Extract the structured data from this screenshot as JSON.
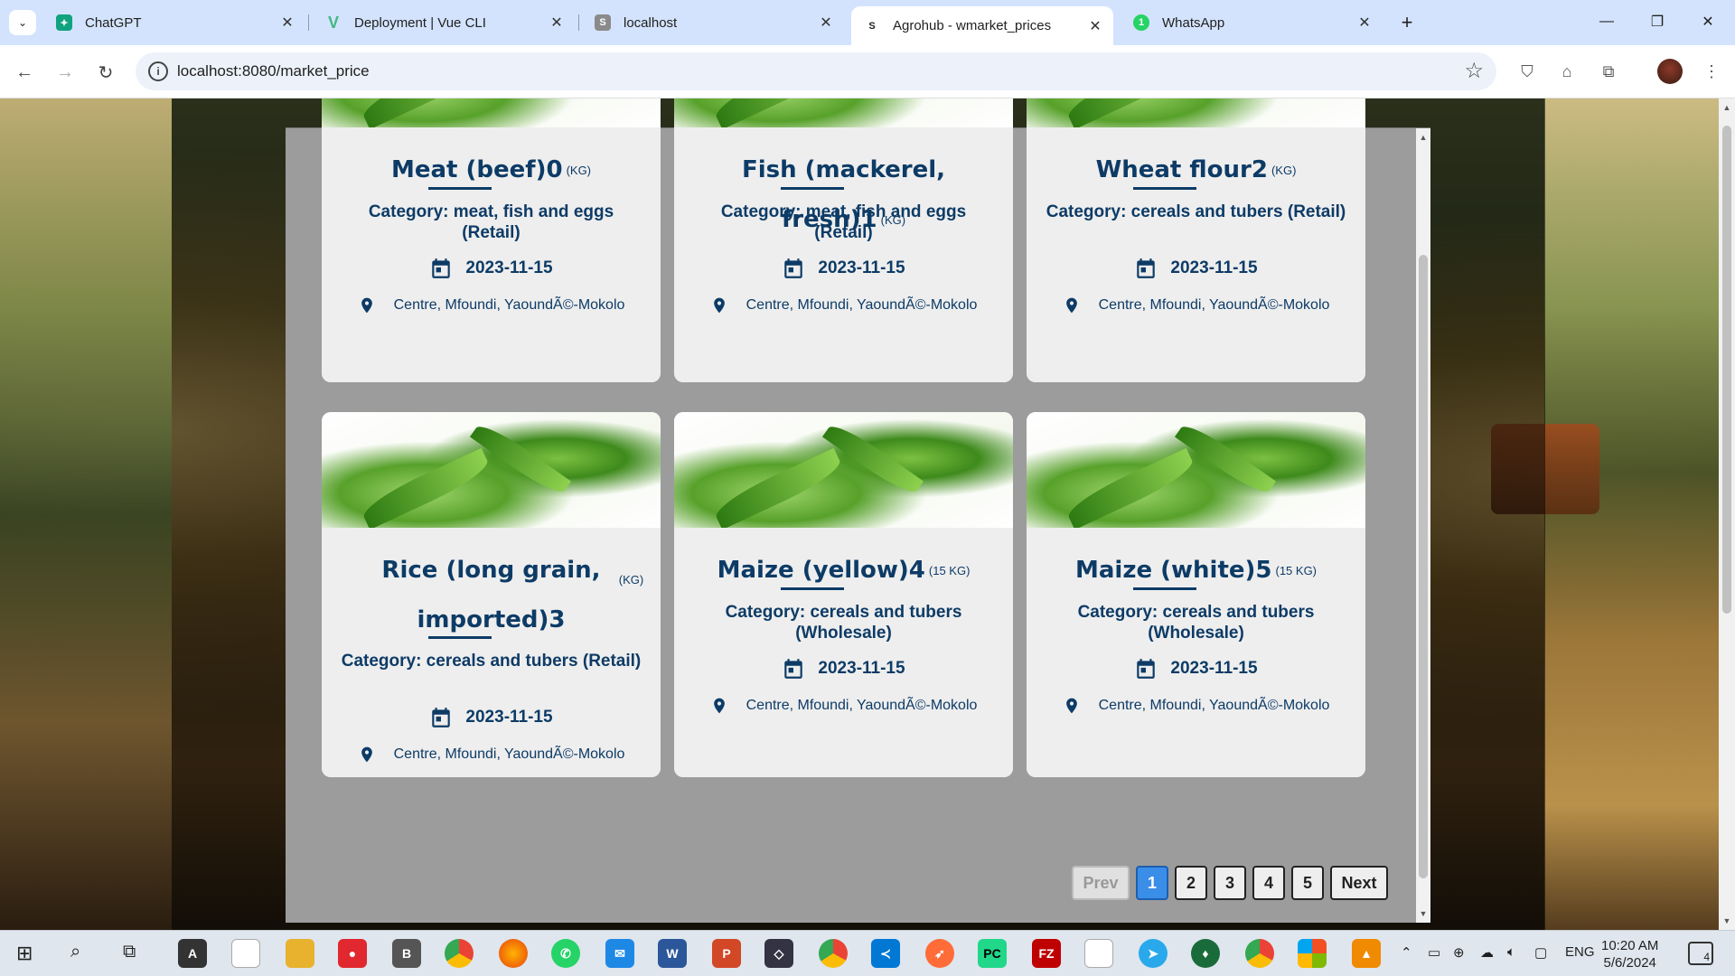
{
  "browser": {
    "tabs": [
      {
        "title": "ChatGPT",
        "fav": "✦",
        "fav_color": "#10a37f"
      },
      {
        "title": "Deployment | Vue CLI",
        "fav": "V",
        "fav_color": "#42b883"
      },
      {
        "title": "localhost",
        "fav": "S",
        "fav_color": "#8a8a8a"
      },
      {
        "title": "Agrohub - wmarket_prices",
        "fav": "S",
        "fav_color": "#1f1f1f"
      },
      {
        "title": "WhatsApp",
        "fav": "1",
        "fav_color": "#25d366"
      }
    ],
    "active_tab_index": 3,
    "url": "localhost:8080/market_price"
  },
  "cards": [
    {
      "name": "Meat (beef)0",
      "unit": "(KG)",
      "category": "Category: meat, fish and eggs (Retail)",
      "date": "2023-11-15",
      "location": "Centre, Mfoundi, YaoundÃ©-Mokolo"
    },
    {
      "name": "Fish (mackerel, fresh)1",
      "unit": "(KG)",
      "category": "Category: meat, fish and eggs (Retail)",
      "date": "2023-11-15",
      "location": "Centre, Mfoundi, YaoundÃ©-Mokolo"
    },
    {
      "name": "Wheat flour2",
      "unit": "(KG)",
      "category": "Category: cereals and tubers (Retail)",
      "date": "2023-11-15",
      "location": "Centre, Mfoundi, YaoundÃ©-Mokolo"
    },
    {
      "name": "Rice (long grain, imported)3",
      "unit": "(KG)",
      "category": "Category: cereals and tubers (Retail)",
      "date": "2023-11-15",
      "location": "Centre, Mfoundi, YaoundÃ©-Mokolo"
    },
    {
      "name": "Maize (yellow)4",
      "unit": "(15 KG)",
      "category": "Category: cereals and tubers (Wholesale)",
      "date": "2023-11-15",
      "location": "Centre, Mfoundi, YaoundÃ©-Mokolo"
    },
    {
      "name": "Maize (white)5",
      "unit": "(15 KG)",
      "category": "Category: cereals and tubers (Wholesale)",
      "date": "2023-11-15",
      "location": "Centre, Mfoundi, YaoundÃ©-Mokolo"
    }
  ],
  "pagination": {
    "prev": "Prev",
    "pages": [
      "1",
      "2",
      "3",
      "4",
      "5"
    ],
    "current": "1",
    "next": "Next"
  },
  "taskbar": {
    "language": "ENG",
    "time": "10:20 AM",
    "date": "5/6/2024",
    "notifications": "4"
  },
  "colors": {
    "accent_text": "#0d3b66",
    "active_page": "#3b8ee8"
  }
}
